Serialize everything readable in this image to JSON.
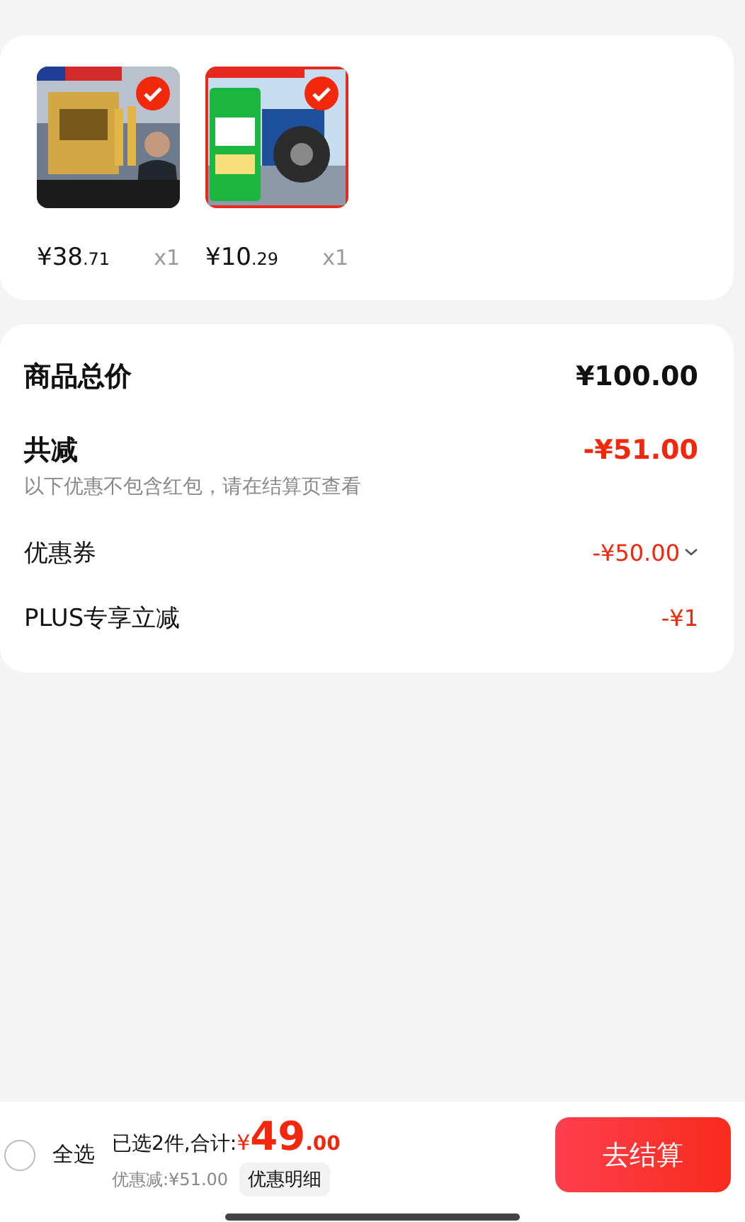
{
  "products": [
    {
      "kind": "picture",
      "selected": true,
      "price_main": "¥38",
      "price_decimal": ".71",
      "quantity": "x1"
    },
    {
      "kind": "picture",
      "selected": true,
      "price_main": "¥10",
      "price_decimal": ".29",
      "quantity": "x1"
    }
  ],
  "summary": {
    "rows": [
      {
        "kind": "total",
        "label": "商品总价",
        "value": "¥100.00"
      },
      {
        "kind": "reduction",
        "label": "共减",
        "value": "-¥51.00",
        "note": "以下优惠不包含红包，请在结算页查看"
      },
      {
        "kind": "discount",
        "label": "优惠券",
        "value": "-¥50.00",
        "expandable": true
      },
      {
        "kind": "discount",
        "label": "PLUS专享立减",
        "value": "-¥1",
        "expandable": false
      }
    ]
  },
  "footer": {
    "select_all": {
      "label": "全选",
      "checked": false
    },
    "selected_text": "已选2件,合计:",
    "currency": "¥",
    "total_main": "49",
    "total_decimal": ".00",
    "saved": "优惠减:¥51.00",
    "details_button": "优惠明细",
    "checkout_button": "去结算"
  }
}
